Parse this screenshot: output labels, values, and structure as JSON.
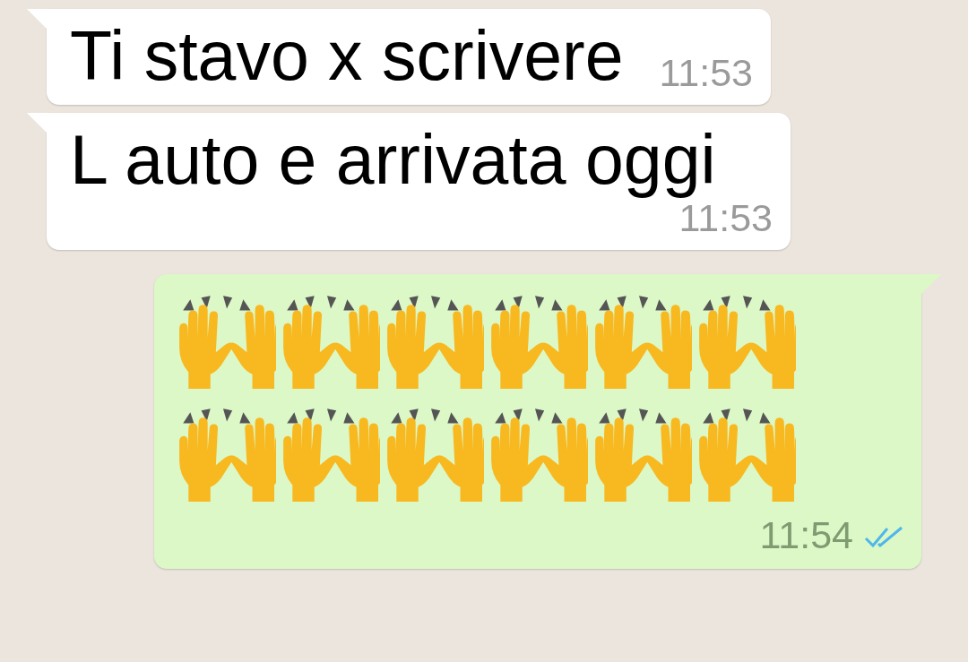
{
  "messages": [
    {
      "kind": "incoming",
      "text": "Ti stavo x scrivere",
      "time": "11:53"
    },
    {
      "kind": "incoming",
      "text": "L auto e arrivata oggi",
      "time": "11:53"
    },
    {
      "kind": "outgoing",
      "emoji_rows": [
        [
          {
            "kind": "raising_hands"
          },
          {
            "kind": "raising_hands"
          },
          {
            "kind": "raising_hands"
          },
          {
            "kind": "raising_hands"
          },
          {
            "kind": "raising_hands"
          },
          {
            "kind": "raising_hands"
          }
        ],
        [
          {
            "kind": "raising_hands"
          },
          {
            "kind": "raising_hands"
          },
          {
            "kind": "raising_hands"
          },
          {
            "kind": "raising_hands"
          },
          {
            "kind": "raising_hands"
          },
          {
            "kind": "raising_hands"
          }
        ]
      ],
      "time": "11:54",
      "read": true
    }
  ]
}
